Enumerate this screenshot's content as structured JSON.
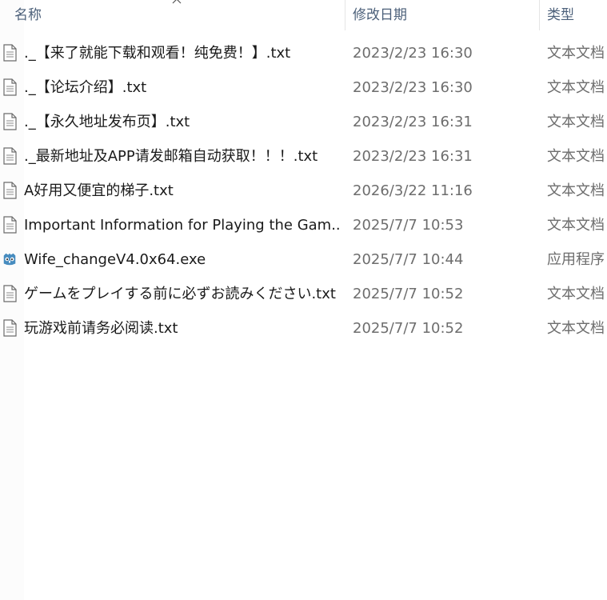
{
  "columns": {
    "name": "名称",
    "date": "修改日期",
    "type": "类型"
  },
  "sort_icon": "chevron-up-icon",
  "files": [
    {
      "name": "._【来了就能下载和观看！纯免费！】.txt",
      "date": "2023/2/23 16:30",
      "type": "文本文档",
      "icon": "text-file-icon"
    },
    {
      "name": "._【论坛介绍】.txt",
      "date": "2023/2/23 16:30",
      "type": "文本文档",
      "icon": "text-file-icon"
    },
    {
      "name": "._【永久地址发布页】.txt",
      "date": "2023/2/23 16:31",
      "type": "文本文档",
      "icon": "text-file-icon"
    },
    {
      "name": "._最新地址及APP请发邮箱自动获取！！！.txt",
      "date": "2023/2/23 16:31",
      "type": "文本文档",
      "icon": "text-file-icon"
    },
    {
      "name": "A好用又便宜的梯子.txt",
      "date": "2026/3/22 11:16",
      "type": "文本文档",
      "icon": "text-file-icon"
    },
    {
      "name": "Important Information for Playing the Gam...",
      "date": "2025/7/7 10:53",
      "type": "文本文档",
      "icon": "text-file-icon"
    },
    {
      "name": "Wife_changeV4.0x64.exe",
      "date": "2025/7/7 10:44",
      "type": "应用程序",
      "icon": "godot-app-icon"
    },
    {
      "name": "ゲームをプレイする前に必ずお読みください.txt",
      "date": "2025/7/7 10:52",
      "type": "文本文档",
      "icon": "text-file-icon"
    },
    {
      "name": "玩游戏前请务必阅读.txt",
      "date": "2025/7/7 10:52",
      "type": "文本文档",
      "icon": "text-file-icon"
    }
  ],
  "colors": {
    "header_text": "#4c607a",
    "name_text": "#1a1a1a",
    "meta_text": "#6d6d6d",
    "app_icon": "#478cbf"
  }
}
